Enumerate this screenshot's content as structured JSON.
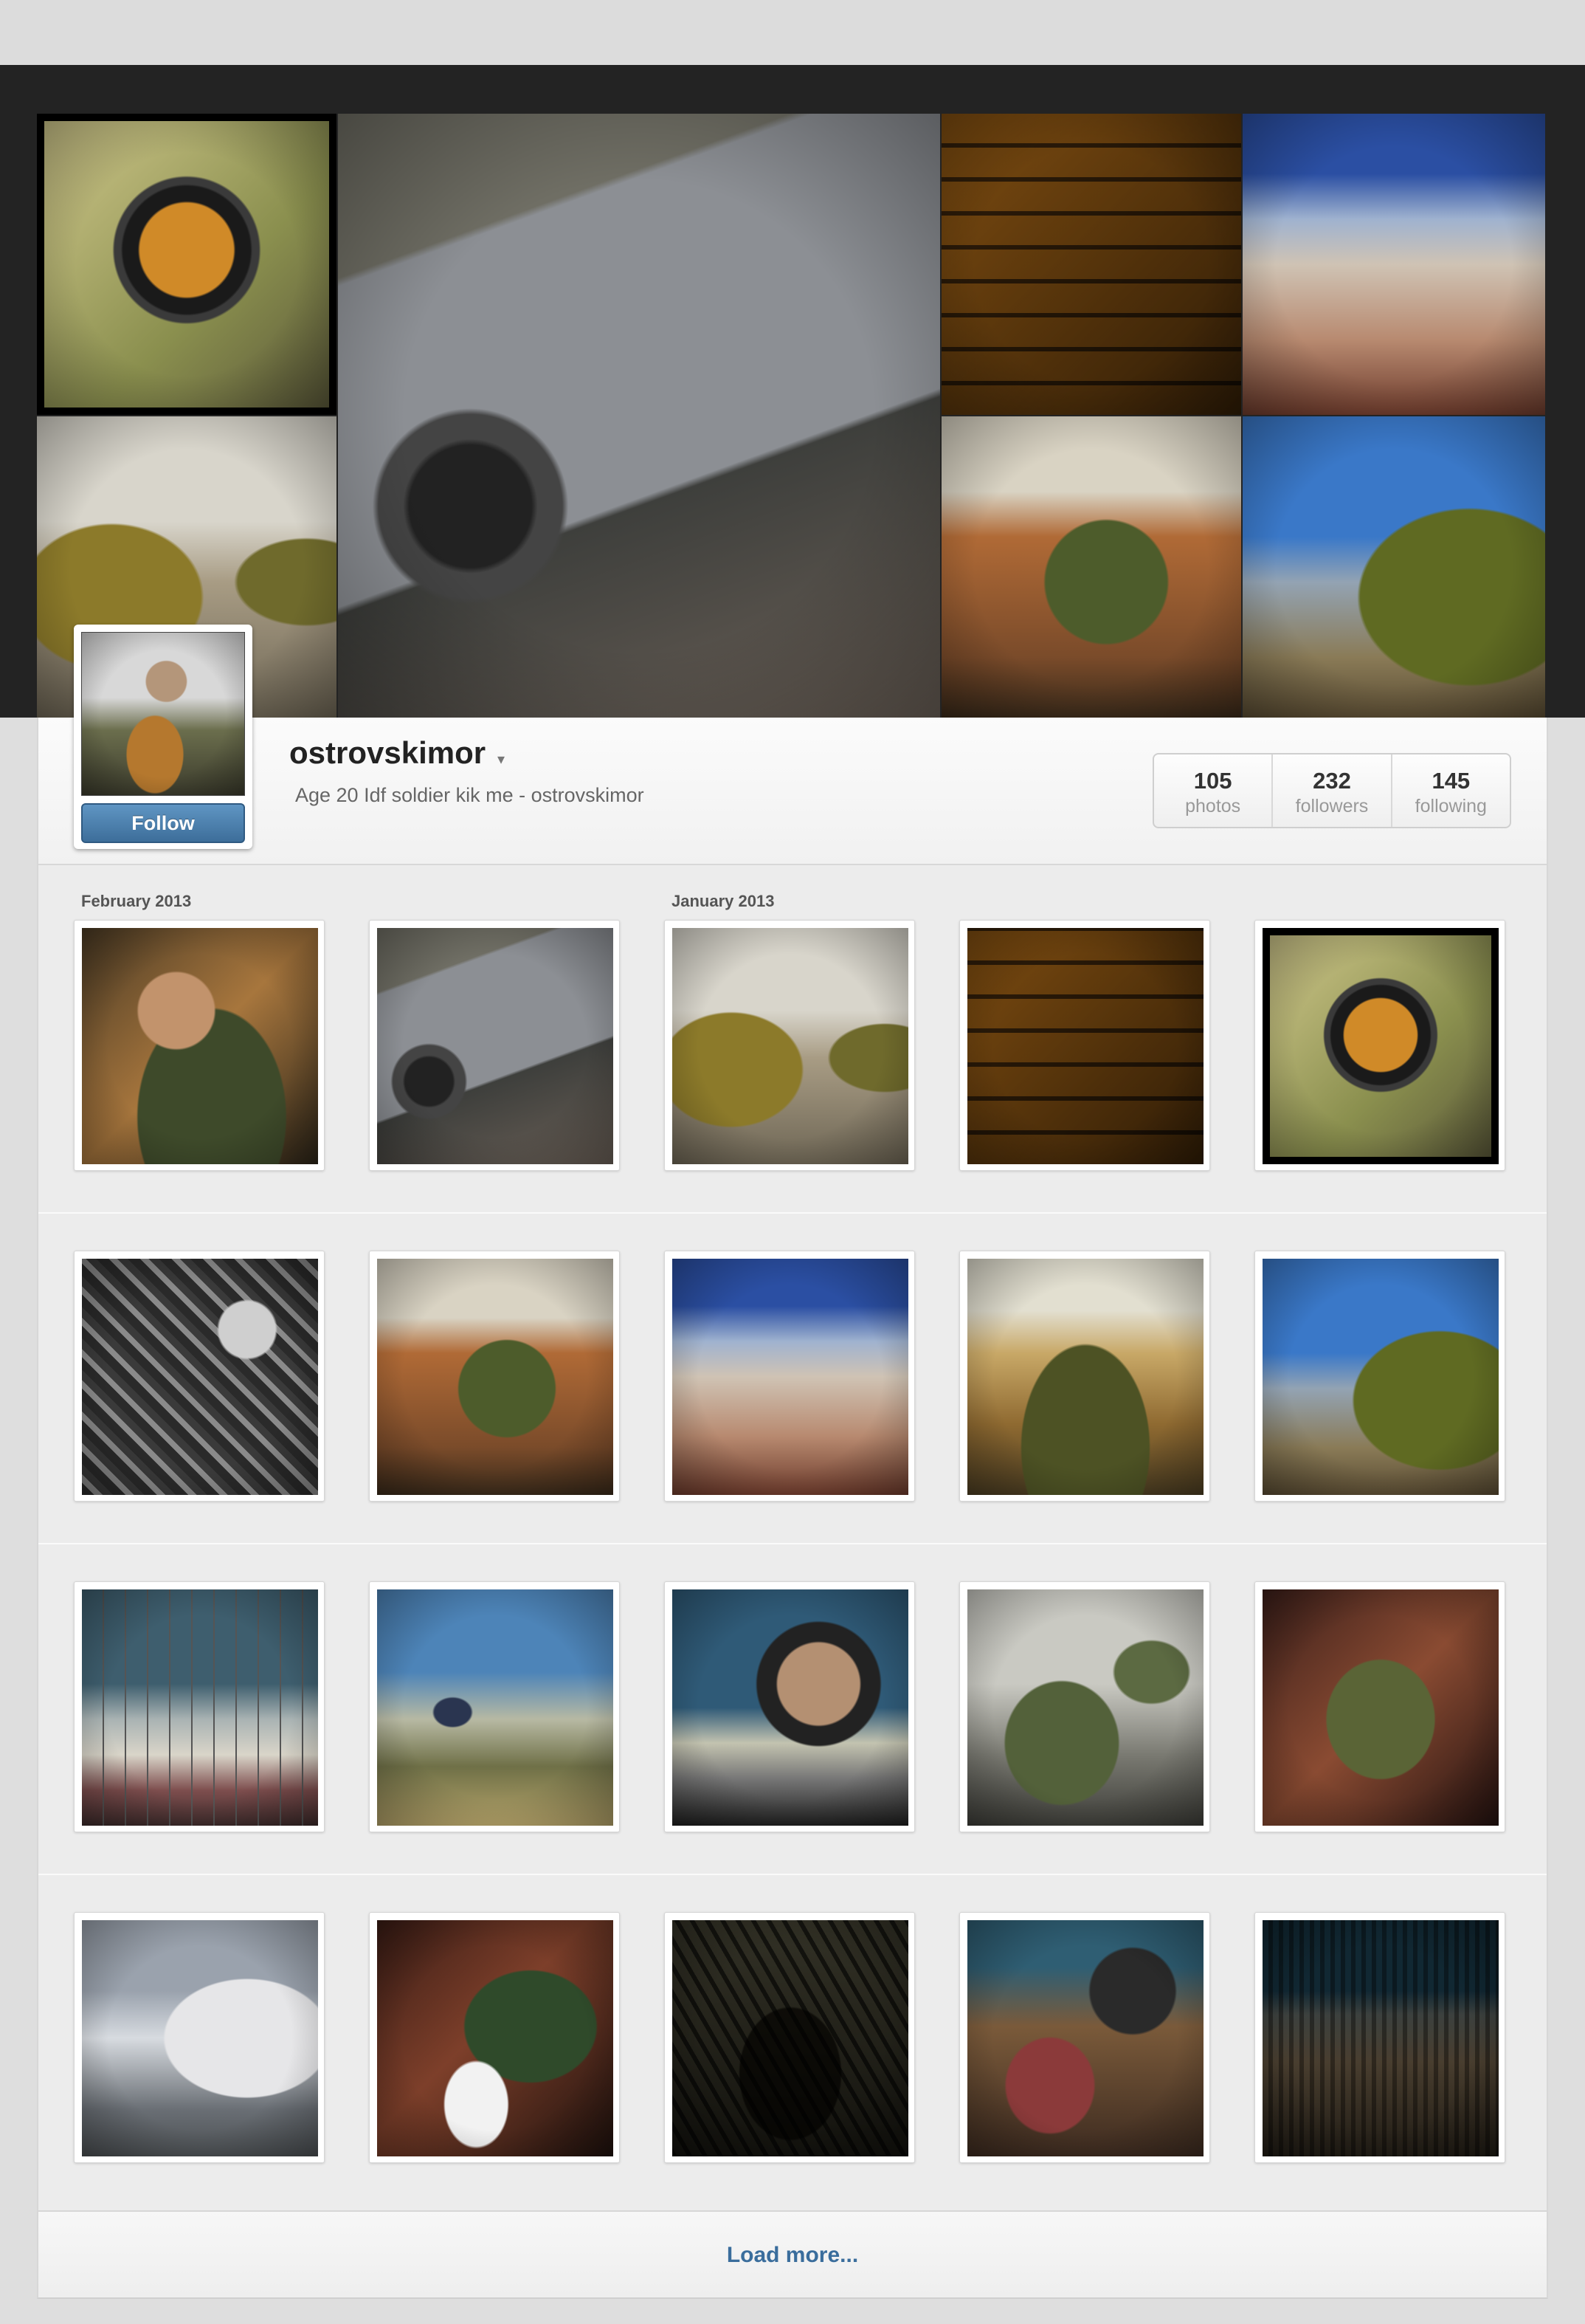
{
  "profile": {
    "username": "ostrovskimor",
    "bio": "Age 20 Idf soldier kik me - ostrovskimor",
    "follow_label": "Follow",
    "caret": "▾"
  },
  "stats": [
    {
      "value": "105",
      "label": "photos"
    },
    {
      "value": "232",
      "label": "followers"
    },
    {
      "value": "145",
      "label": "following"
    }
  ],
  "months": [
    "February 2013",
    "January 2013"
  ],
  "load_more_label": "Load more...",
  "banner_tiles": [
    "rifle-scope",
    "military-jeep",
    "stone-wall-shadows",
    "hilltop-sky",
    "hooded-soldiers",
    "soldier-on-sofa",
    "soldier-backpack-view"
  ],
  "photos": [
    "soldier-face",
    "military-jeep",
    "hooded-soldiers",
    "stone-wall-shadows",
    "rifle-scope",
    "black-white-portrait",
    "soldier-on-sofa",
    "hilltop-sky",
    "rifle-field-view",
    "soldier-backpack-view",
    "barbed-wire",
    "man-on-hill",
    "helmet-selfie",
    "sleeping-soldiers",
    "soldier-with-rifle",
    "snow-car",
    "snowman",
    "graffiti-wall",
    "meat-plate",
    "city-view"
  ],
  "colors": {
    "follow_button": "#4a7fad",
    "load_more_text": "#3a6d9c",
    "banner_bg": "#232323",
    "page_bg": "#dedede"
  }
}
